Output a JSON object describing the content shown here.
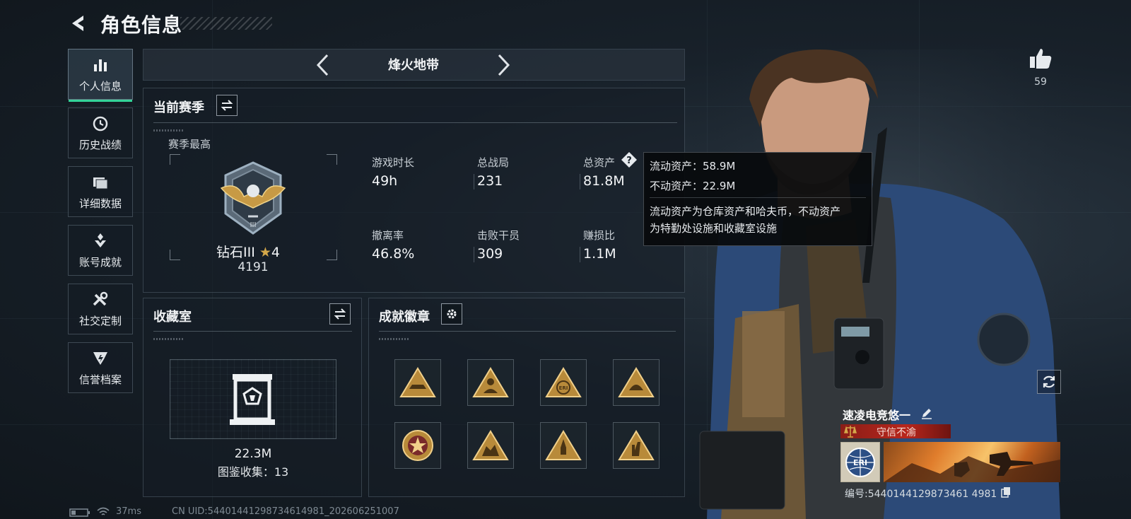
{
  "header": {
    "title": "角色信息"
  },
  "nav": {
    "items": [
      {
        "label": "个人信息",
        "icon": "bar-chart-icon"
      },
      {
        "label": "历史战绩",
        "icon": "history-icon"
      },
      {
        "label": "详细数据",
        "icon": "folder-icon"
      },
      {
        "label": "账号成就",
        "icon": "achievement-icon"
      },
      {
        "label": "社交定制",
        "icon": "tools-icon"
      },
      {
        "label": "信誉档案",
        "icon": "shield-icon"
      }
    ]
  },
  "mode": {
    "label": "烽火地带"
  },
  "season": {
    "title": "当前赛季",
    "best_label": "赛季最高",
    "rank_name": "钻石III",
    "rank_stars": "4",
    "rank_score": "4191",
    "stats": [
      {
        "label": "游戏时长",
        "value": "49h"
      },
      {
        "label": "总战局",
        "value": "231"
      },
      {
        "label": "总资产",
        "value": "81.8M"
      },
      {
        "label": "撤离率",
        "value": "46.8%"
      },
      {
        "label": "击败干员",
        "value": "309"
      },
      {
        "label": "赚损比",
        "value": "1.1M"
      }
    ]
  },
  "tooltip": {
    "line1": "流动资产：58.9M",
    "line2": "不动资产：22.9M",
    "desc1": "流动资产为仓库资产和哈夫币，不动资产",
    "desc2": "为特勤处设施和收藏室设施"
  },
  "collection": {
    "title": "收藏室",
    "value": "22.3M",
    "count_text": "图鉴收集：13"
  },
  "badges": {
    "title": "成就徽章",
    "items": [
      "badge-vehicle-icon",
      "badge-soldier-icon",
      "badge-eri-icon",
      "badge-hands-icon",
      "badge-star-emblem-icon",
      "badge-squad-icon",
      "badge-rocket-icon",
      "badge-hand-sign-icon"
    ]
  },
  "profile": {
    "likes": "59",
    "name": "速凌电竞悠一",
    "honor": "守信不渝",
    "uid": "编号:5440144129873461 4981"
  },
  "status": {
    "ping": "37ms",
    "uid": "CN UID:54401441298734614981_202606251007"
  },
  "colors": {
    "accent": "#34d399",
    "honor": "#b8261c",
    "gold": "#d4a84a"
  }
}
